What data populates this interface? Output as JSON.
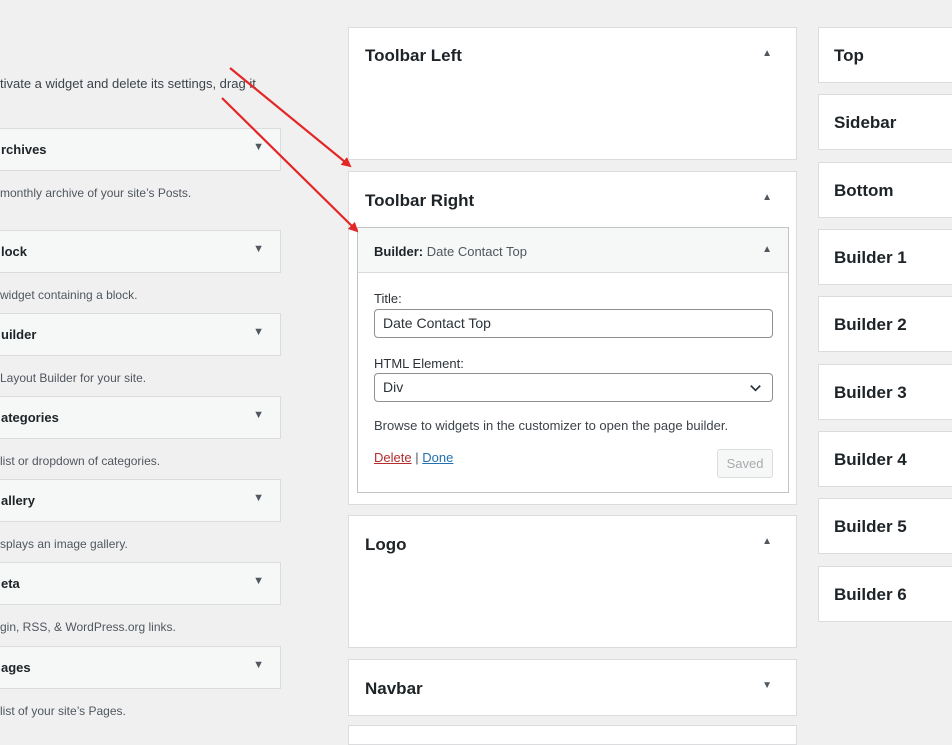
{
  "intro_text": "tivate a widget and delete its settings, drag it",
  "available_widgets": [
    {
      "title": "rchives",
      "desc": "monthly archive of your site’s Posts."
    },
    {
      "title": "lock",
      "desc": "widget containing a block."
    },
    {
      "title": "uilder",
      "desc": "Layout Builder for your site."
    },
    {
      "title": "ategories",
      "desc": "list or dropdown of categories."
    },
    {
      "title": "allery",
      "desc": "splays an image gallery."
    },
    {
      "title": "eta",
      "desc": "gin, RSS, & WordPress.org links."
    },
    {
      "title": "ages",
      "desc": "list of your site’s Pages."
    }
  ],
  "sidebars": [
    {
      "title": "Toolbar Left"
    },
    {
      "title": "Toolbar Right"
    },
    {
      "title": "Logo"
    },
    {
      "title": "Navbar"
    }
  ],
  "right_areas": [
    {
      "title": "Top"
    },
    {
      "title": "Sidebar"
    },
    {
      "title": "Bottom"
    },
    {
      "title": "Builder 1"
    },
    {
      "title": "Builder 2"
    },
    {
      "title": "Builder 3"
    },
    {
      "title": "Builder 4"
    },
    {
      "title": "Builder 5"
    },
    {
      "title": "Builder 6"
    }
  ],
  "widget": {
    "name": "Builder",
    "separator": ":",
    "subtitle": "Date Contact Top",
    "title_label": "Title:",
    "title_value": "Date Contact Top",
    "html_label": "HTML Element:",
    "html_value": "Div",
    "browse_text": "Browse to widgets in the customizer to open the page builder.",
    "delete_label": "Delete",
    "link_separator": "|",
    "done_label": "Done",
    "saved_label": "Saved"
  },
  "icons": {
    "collapsed": "▼",
    "expanded": "▲"
  },
  "colors": {
    "annotation_arrow": "#e32626",
    "delete_link": "#b32d2e",
    "done_link": "#2271b1"
  }
}
